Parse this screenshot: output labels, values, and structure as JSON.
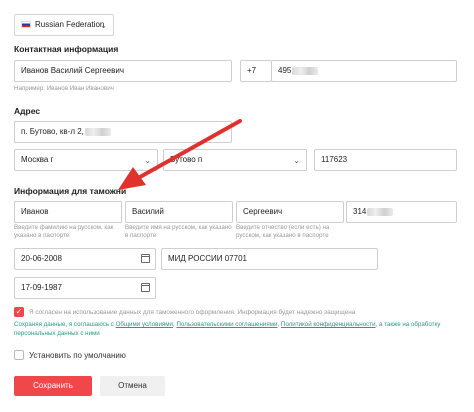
{
  "country": {
    "label": "Russian Federation"
  },
  "contact": {
    "heading": "Контактная информация",
    "name_value": "Иванов Василий Сергеевич",
    "name_hint": "Например: Иванов Иван Иванович",
    "phone_code": "+7",
    "phone_value": "495"
  },
  "address": {
    "heading": "Адрес",
    "street_value": "п. Бутово, кв-л 2,",
    "region_value": "Москва г",
    "city_value": "Бутово п",
    "zip_value": "117623"
  },
  "customs": {
    "heading": "Информация для таможни",
    "last_name": "Иванов",
    "last_name_hint": "Введите фамилию на русском, как указано в паспорте",
    "first_name": "Василий",
    "first_name_hint": "Введите имя на русском, как указано в паспорте",
    "patronymic": "Сергеевич",
    "patronymic_hint": "Введите отчество (если есть) на русском, как указано в паспорте",
    "passport": "314",
    "issue_date": "20-06-2008",
    "issuer": "МИД РОССИИ 07701",
    "birth_date": "17-09-1987"
  },
  "consent": {
    "text": "Я согласен на использование данных для таможенного оформления. Информация будет надежно защищена",
    "legal_prefix": "Сохраняя данные, я соглашаюсь с ",
    "link1": "Общими условиями",
    "sep1": ", ",
    "link2": "Пользовательскими соглашениями",
    "sep2": ", ",
    "link3": "Политикой конфиденциальности",
    "legal_suffix": ", а также на обработку персональных данных с ними"
  },
  "default_label": "Установить по умолчанию",
  "buttons": {
    "save": "Сохранить",
    "cancel": "Отмена"
  },
  "colors": {
    "accent": "#f0474b",
    "link": "#2a9a86",
    "arrow": "#e0322d"
  }
}
